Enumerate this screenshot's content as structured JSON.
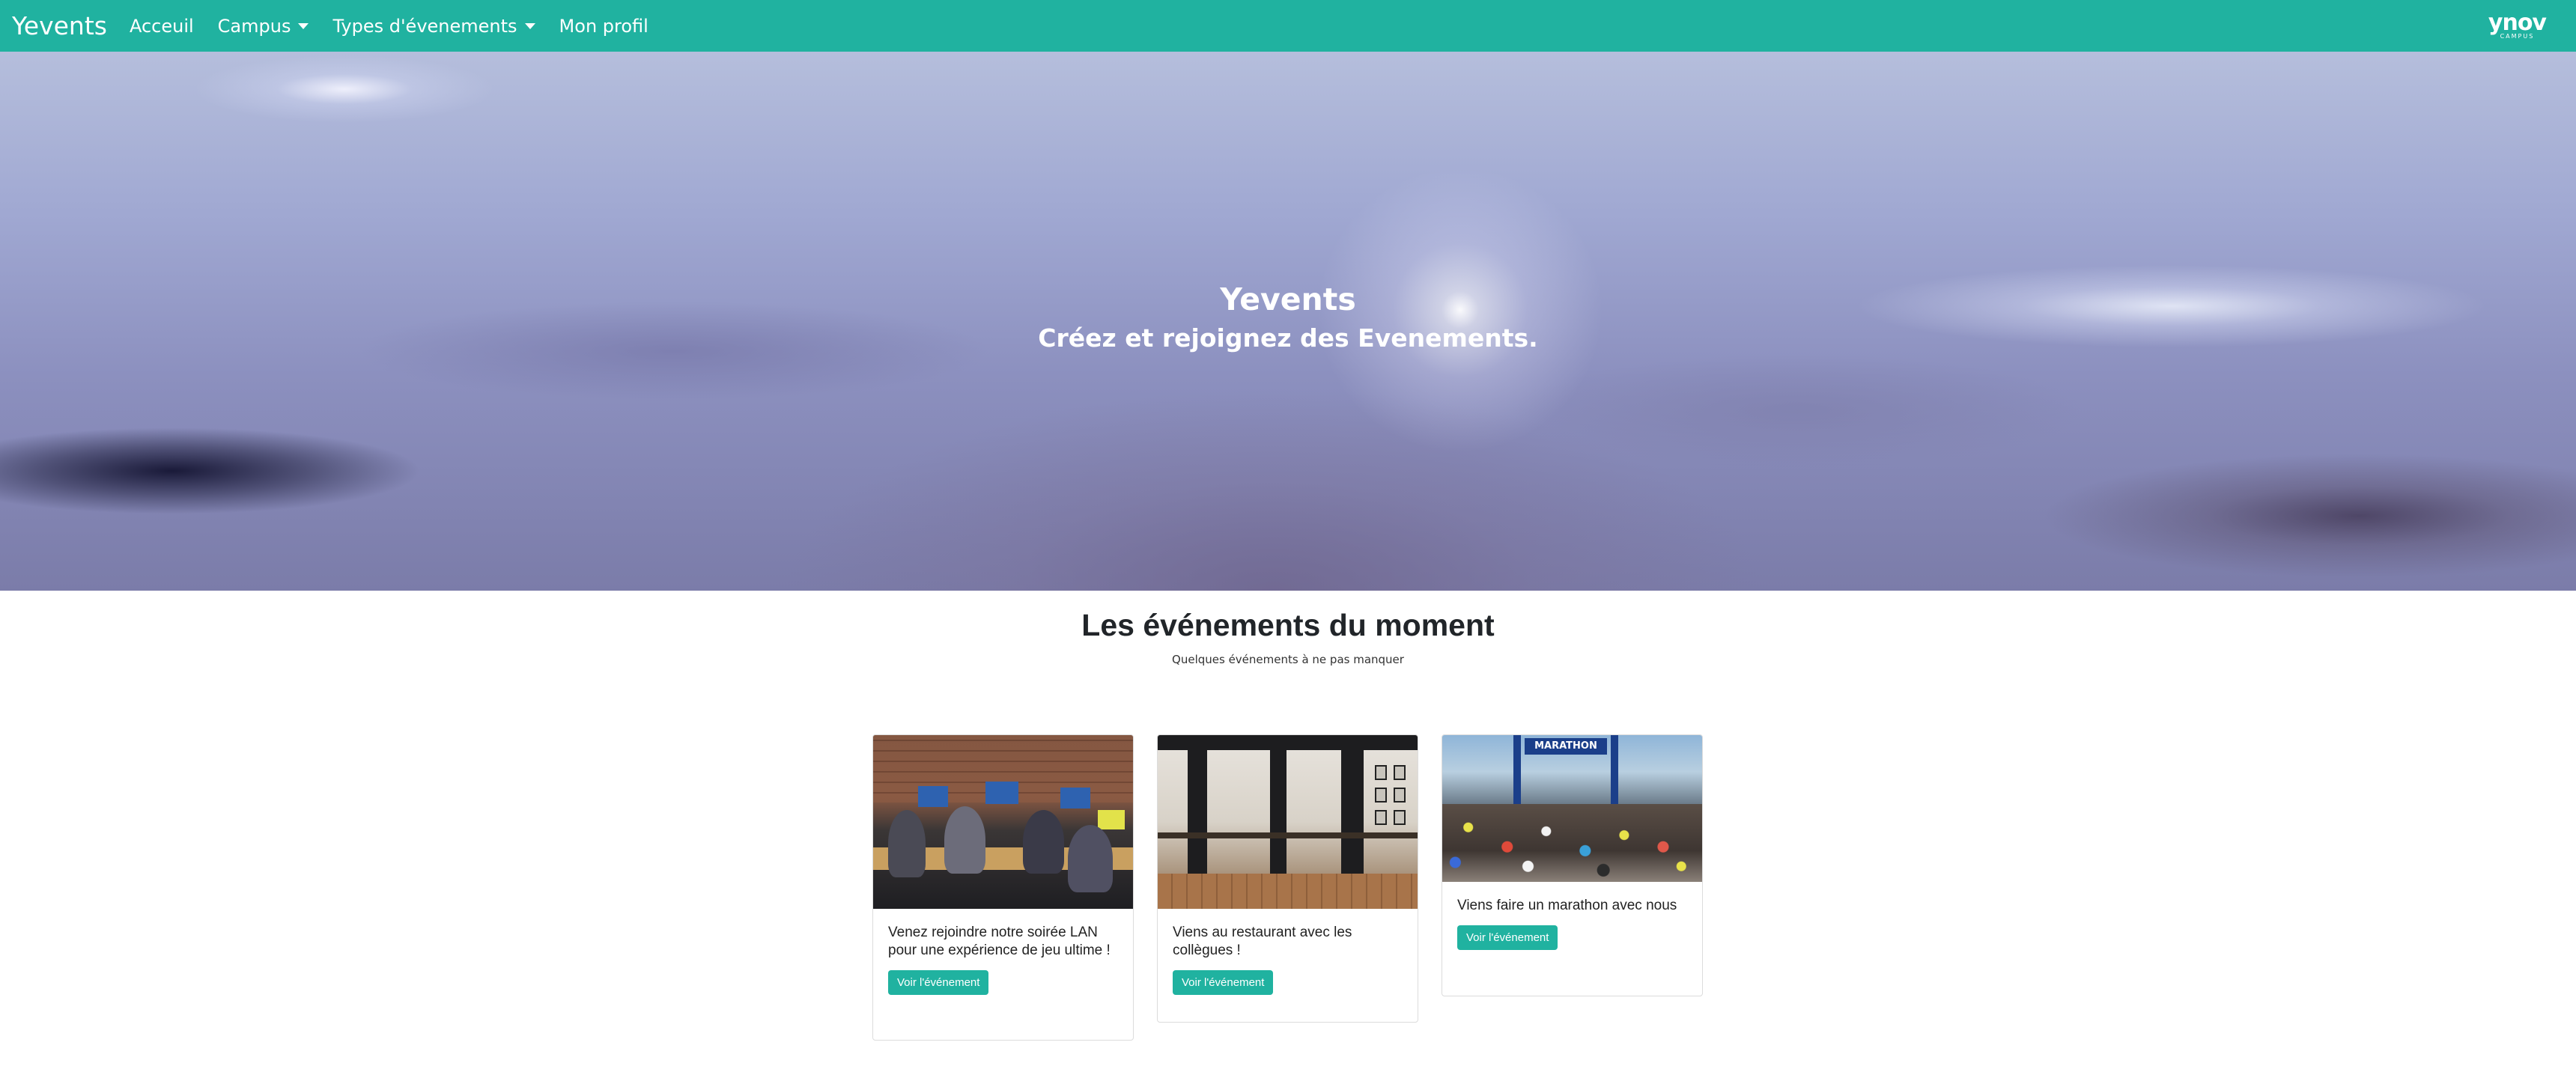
{
  "navbar": {
    "brand": "Yevents",
    "links": [
      {
        "label": "Acceuil",
        "dropdown": false
      },
      {
        "label": "Campus",
        "dropdown": true
      },
      {
        "label": "Types d'évenements",
        "dropdown": true
      },
      {
        "label": "Mon profil",
        "dropdown": false
      }
    ],
    "logo_main": "ynov",
    "logo_sub": "CAMPUS",
    "color": "#20b2a0"
  },
  "hero": {
    "title": "Yevents",
    "subtitle": "Créez et rejoignez des Evenements."
  },
  "section": {
    "title": "Les événements du moment",
    "subtitle": "Quelques événements à ne pas manquer"
  },
  "cards": [
    {
      "title": "Venez rejoindre notre soirée LAN pour une expérience de jeu ultime !",
      "button": "Voir l'événement",
      "image": "lan-party-image"
    },
    {
      "title": "Viens au restaurant avec les collègues !",
      "button": "Voir l'événement",
      "image": "restaurant-image"
    },
    {
      "title": "Viens faire un marathon avec nous",
      "button": "Voir l'événement",
      "image": "marathon-image"
    }
  ],
  "marathon_banner": "MARATHON"
}
